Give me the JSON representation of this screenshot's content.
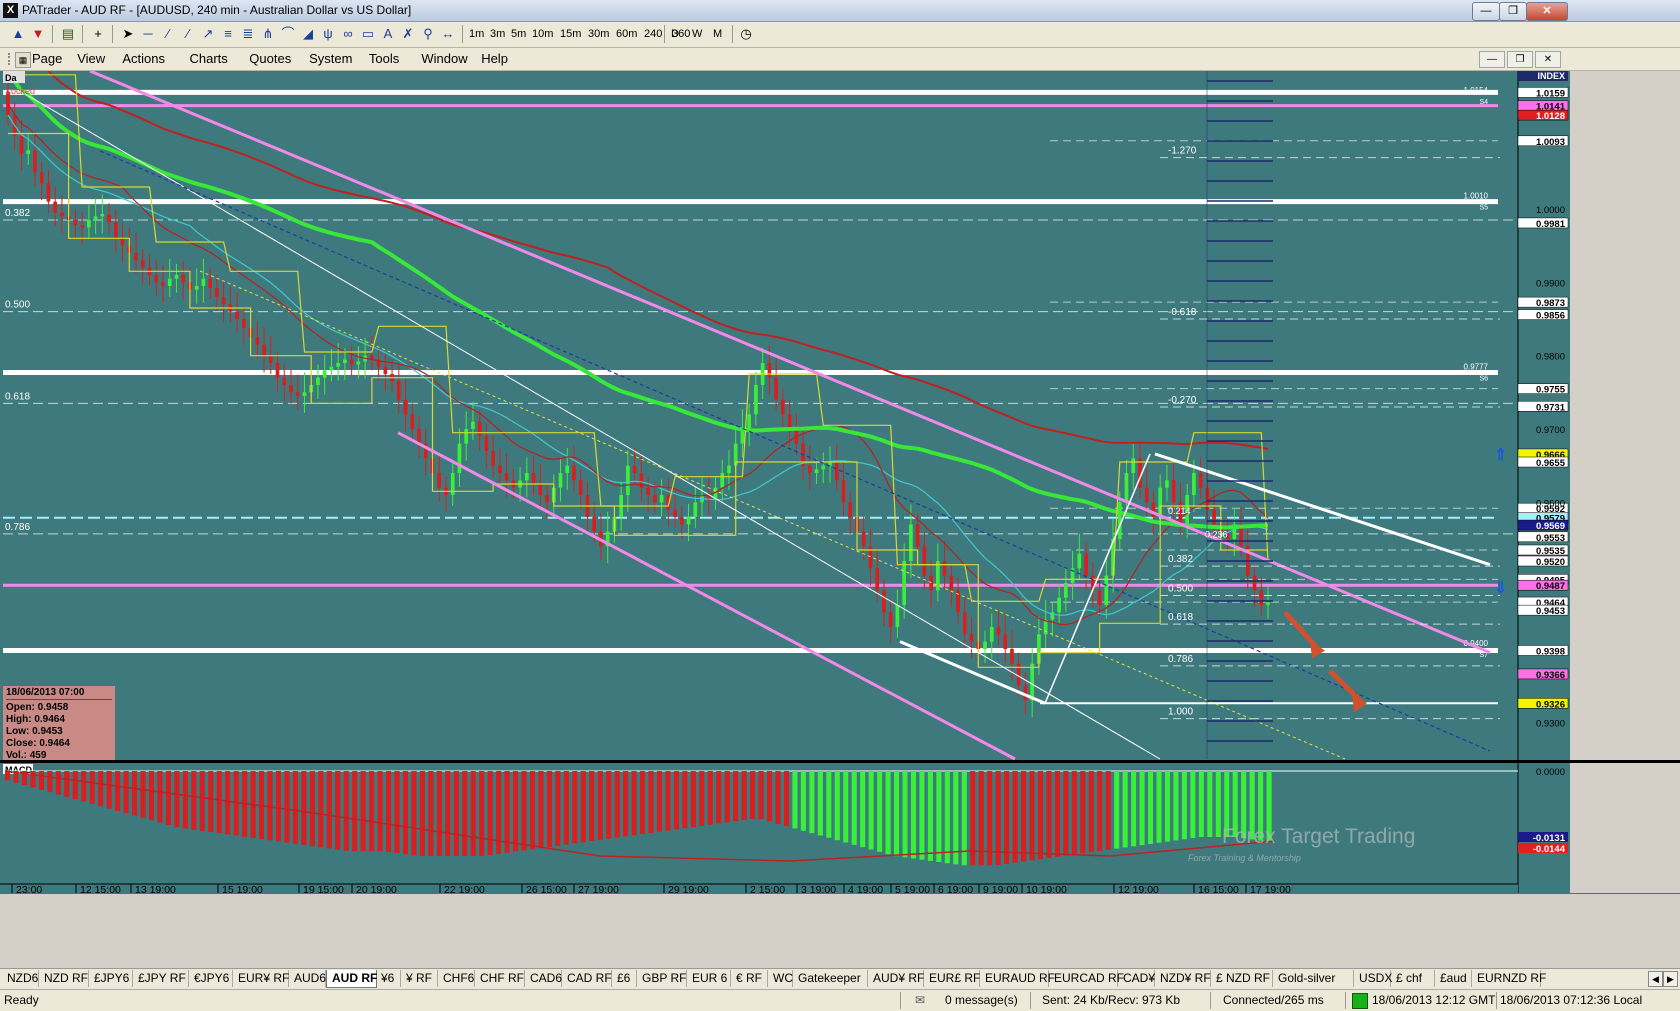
{
  "window": {
    "title": "PATrader - AUD RF - [AUDUSD, 240 min - Australian Dollar vs US Dollar]",
    "app_icon": "X"
  },
  "toolbar": {
    "timeframes": [
      "1m",
      "3m",
      "5m",
      "10m",
      "15m",
      "30m",
      "60m",
      "240",
      "360"
    ],
    "periods": [
      "D",
      "W",
      "M"
    ]
  },
  "menu": {
    "items": [
      "Page",
      "View",
      "Actions",
      "Charts",
      "Quotes",
      "System",
      "Tools",
      "Window",
      "Help"
    ]
  },
  "chart": {
    "corner_label": "Da",
    "locked_label": "Locked",
    "index_label": "INDEX",
    "left_fib_labels": [
      {
        "text": "0.382",
        "price": 0.9985
      },
      {
        "text": "0.500",
        "price": 0.986
      },
      {
        "text": "0.618",
        "price": 0.9735
      },
      {
        "text": "0.786",
        "price": 0.9557
      }
    ],
    "fib_ext_labels": [
      {
        "text": "-1.270",
        "price": 1.007
      },
      {
        "text": "-0.618",
        "price": 0.985
      },
      {
        "text": "-0.270",
        "price": 0.973
      },
      {
        "text": "0.382",
        "price": 0.9513
      },
      {
        "text": "0.500",
        "price": 0.9473
      },
      {
        "text": "0.618",
        "price": 0.9434
      },
      {
        "text": "0.786",
        "price": 0.9377
      },
      {
        "text": "1.000",
        "price": 0.9305
      }
    ],
    "pivot_labels": [
      {
        "text": "1.0154",
        "tag": "S4",
        "price": 1.0154
      },
      {
        "text": "1.0010",
        "tag": "S5",
        "price": 1.001
      },
      {
        "text": "0.9777",
        "tag": "S6",
        "price": 0.9777
      },
      {
        "text": "0.9400",
        "tag": "S7",
        "price": 0.94
      }
    ],
    "price_badges": [
      {
        "text": "1.0159",
        "color": "#ffffff",
        "price": 1.0159
      },
      {
        "text": "1.0141",
        "color": "#ff6fe6",
        "price": 1.0141
      },
      {
        "text": "1.0128",
        "color": "#e02020",
        "price": 1.0128
      },
      {
        "text": "1.0093",
        "color": "#ffffff",
        "price": 1.0093
      },
      {
        "text": "0.9981",
        "color": "#ffffff",
        "price": 0.9981
      },
      {
        "text": "0.9873",
        "color": "#ffffff",
        "price": 0.9873
      },
      {
        "text": "0.9856",
        "color": "#ffffff",
        "price": 0.9856
      },
      {
        "text": "0.9755",
        "color": "#ffffff",
        "price": 0.9755
      },
      {
        "text": "0.9731",
        "color": "#ffffff",
        "price": 0.9731
      },
      {
        "text": "0.9666",
        "color": "#f4f400",
        "price": 0.9666
      },
      {
        "text": "0.9655",
        "color": "#ffffff",
        "price": 0.9655
      },
      {
        "text": "0.9592",
        "color": "#ffffff",
        "price": 0.9592
      },
      {
        "text": "0.9579",
        "color": "#a0f0ff",
        "price": 0.9579
      },
      {
        "text": "0.9569",
        "color": "#1a1a8a",
        "price": 0.9569
      },
      {
        "text": "0.9553",
        "color": "#ffffff",
        "price": 0.9553
      },
      {
        "text": "0.9535",
        "color": "#ffffff",
        "price": 0.9535
      },
      {
        "text": "0.9520",
        "color": "#ffffff",
        "price": 0.952
      },
      {
        "text": "0.9495",
        "color": "#ffffff",
        "price": 0.9495
      },
      {
        "text": "0.9487",
        "color": "#ff6fe6",
        "price": 0.9487
      },
      {
        "text": "0.9464",
        "color": "#ffffff",
        "price": 0.9464
      },
      {
        "text": "0.9453",
        "color": "#ffffff",
        "price": 0.9453
      },
      {
        "text": "0.9398",
        "color": "#ffffff",
        "price": 0.9398
      },
      {
        "text": "0.9366",
        "color": "#ff6fe6",
        "price": 0.9366
      },
      {
        "text": "0.9326",
        "color": "#f4f400",
        "price": 0.9326
      }
    ],
    "axis_ticks": [
      "1.0000",
      "0.9900",
      "0.9800",
      "0.9700",
      "0.9600",
      "0.9300"
    ],
    "fib_box": [
      "0.214",
      "0.236"
    ],
    "macd_label": "MACD",
    "macd_axis": [
      "0.0000",
      "-0.0131",
      "-0.0144"
    ],
    "time_labels": [
      "23:00",
      "12 15:00",
      "13 19:00",
      "15 19:00",
      "19 15:00",
      "20 19:00",
      "22 19:00",
      "26 15:00",
      "27 19:00",
      "29 19:00",
      "2 15:00",
      "3 19:00",
      "4 19:00",
      "5 19:00",
      "6 19:00",
      "9 19:00",
      "10 19:00",
      "12 19:00",
      "16 15:00",
      "17 19:00"
    ],
    "watermark_title": "Forex Target Trading",
    "watermark_sub": "Forex Training & Mentorship",
    "accent_colors": {
      "bg": "#3e7a7d",
      "up": "#38f038",
      "down": "#d81e1e",
      "pink": "#f08ae8",
      "yellow": "#d8d830",
      "cyan": "#40c8d0"
    }
  },
  "ohlc": {
    "date": "18/06/2013 07:00",
    "open": "Open: 0.9458",
    "high": "High: 0.9464",
    "low": "Low: 0.9453",
    "close": "Close: 0.9464",
    "vol": "Vol.: 459"
  },
  "tabs": [
    "NZD6",
    "NZD RF",
    "£JPY6",
    "£JPY RF",
    "€JPY6",
    "EUR¥ RF",
    "AUD6",
    "AUD RF",
    "¥6",
    "¥ RF",
    "CHF6",
    "CHF RF",
    "CAD6",
    "CAD RF",
    "£6",
    "GBP RF",
    "EUR 6",
    "€ RF",
    "WC",
    "Gatekeeper",
    "AUD¥ RF",
    "EUR£ RF",
    "EURAUD RF",
    "EURCAD RF",
    "CAD¥",
    "NZD¥ RF",
    "£ NZD RF",
    "Gold-silver",
    "USDX",
    "£ chf",
    "£aud",
    "EURNZD RF"
  ],
  "active_tab": "AUD RF",
  "status": {
    "ready": "Ready",
    "messages": "0 message(s)",
    "traffic": "Sent: 24 Kb/Recv: 973 Kb",
    "connection": "Connected/265 ms",
    "gmt_time": "18/06/2013 12:12 GMT",
    "local_time": "18/06/2013 07:12:36 Local"
  },
  "chart_data": {
    "type": "candlestick",
    "instrument": "AUDUSD",
    "timeframe": "240 min",
    "ylim": [
      0.925,
      1.018
    ],
    "last": {
      "open": 0.9458,
      "high": 0.9464,
      "low": 0.9453,
      "close": 0.9464,
      "volume": 459
    },
    "candles_close": [
      1.0128,
      1.01,
      1.0075,
      1.008,
      1.005,
      1.0035,
      1.001,
      0.9995,
      0.999,
      0.9985,
      0.9978,
      0.9975,
      0.9985,
      0.999,
      0.9993,
      0.9982,
      0.996,
      0.995,
      0.994,
      0.993,
      0.992,
      0.991,
      0.99,
      0.9895,
      0.9905,
      0.991,
      0.99,
      0.989,
      0.9895,
      0.9905,
      0.9892,
      0.988,
      0.987,
      0.986,
      0.985,
      0.9838,
      0.9825,
      0.9815,
      0.98,
      0.979,
      0.977,
      0.976,
      0.975,
      0.9745,
      0.975,
      0.976,
      0.977,
      0.978,
      0.9785,
      0.979,
      0.9795,
      0.9788,
      0.9792,
      0.98,
      0.9795,
      0.9785,
      0.9775,
      0.9765,
      0.974,
      0.972,
      0.97,
      0.968,
      0.966,
      0.964,
      0.962,
      0.961,
      0.964,
      0.968,
      0.97,
      0.971,
      0.969,
      0.967,
      0.965,
      0.964,
      0.963,
      0.962,
      0.963,
      0.964,
      0.9625,
      0.961,
      0.96,
      0.962,
      0.964,
      0.965,
      0.963,
      0.961,
      0.958,
      0.956,
      0.954,
      0.956,
      0.958,
      0.961,
      0.965,
      0.964,
      0.962,
      0.961,
      0.96,
      0.961,
      0.959,
      0.958,
      0.957,
      0.958,
      0.96,
      0.961,
      0.9605,
      0.962,
      0.964,
      0.965,
      0.968,
      0.97,
      0.972,
      0.976,
      0.979,
      0.977,
      0.974,
      0.972,
      0.97,
      0.968,
      0.965,
      0.964,
      0.9645,
      0.965,
      0.9655,
      0.963,
      0.96,
      0.958,
      0.956,
      0.954,
      0.951,
      0.948,
      0.945,
      0.943,
      0.946,
      0.952,
      0.957,
      0.954,
      0.95,
      0.948,
      0.952,
      0.95,
      0.948,
      0.945,
      0.942,
      0.941,
      0.94,
      0.941,
      0.943,
      0.942,
      0.94,
      0.938,
      0.935,
      0.933,
      0.938,
      0.942,
      0.944,
      0.945,
      0.947,
      0.949,
      0.951,
      0.953,
      0.95,
      0.948,
      0.946,
      0.95,
      0.955,
      0.96,
      0.964,
      0.966,
      0.962,
      0.96,
      0.958,
      0.962,
      0.963,
      0.96,
      0.957,
      0.961,
      0.964,
      0.962,
      0.959,
      0.957,
      0.956,
      0.955,
      0.957,
      0.954,
      0.95,
      0.948,
      0.946,
      0.9464
    ],
    "series": [
      {
        "name": "MACD",
        "values": [
          -0.002,
          -0.004,
          -0.006,
          -0.008,
          -0.01,
          -0.012,
          -0.013,
          -0.014,
          -0.015,
          -0.016,
          -0.017,
          -0.017,
          -0.018,
          -0.018,
          -0.018,
          -0.017,
          -0.016,
          -0.015,
          -0.014,
          -0.013,
          -0.012,
          -0.011,
          -0.01,
          -0.012,
          -0.014,
          -0.016,
          -0.018,
          -0.019,
          -0.02,
          -0.02,
          -0.019,
          -0.018,
          -0.017,
          -0.016,
          -0.015,
          -0.014,
          -0.014,
          -0.015
        ]
      }
    ]
  }
}
